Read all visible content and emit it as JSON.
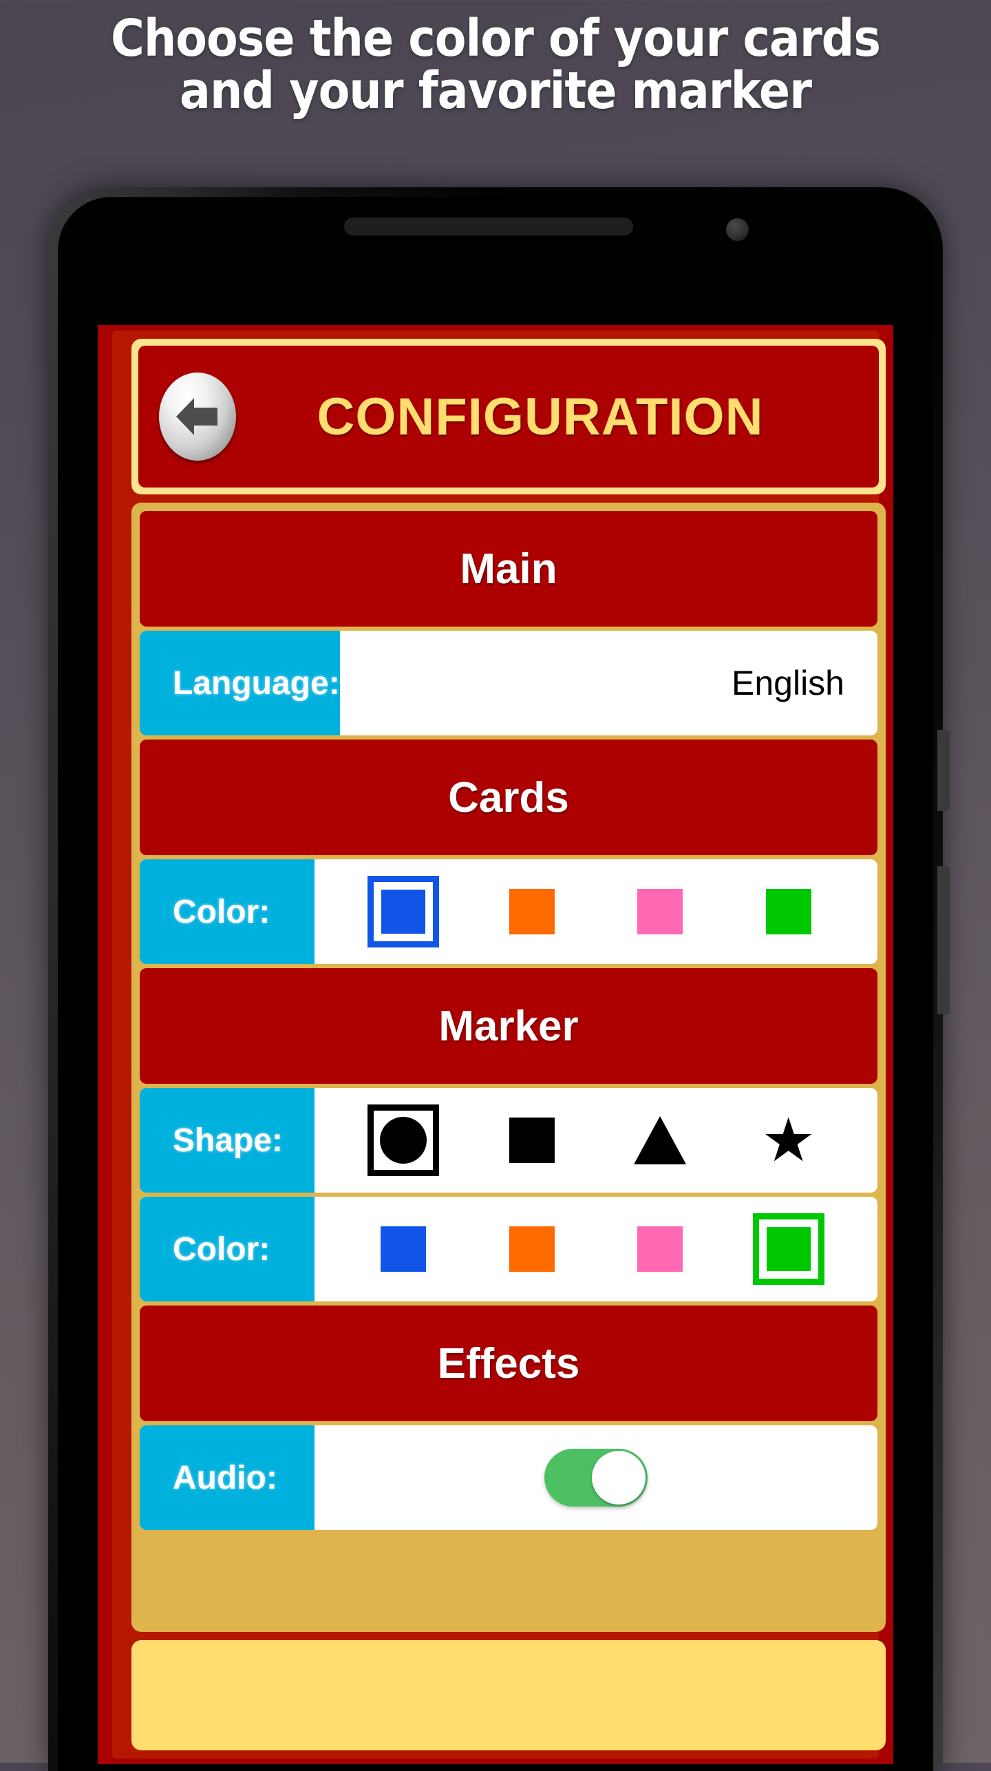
{
  "headline": {
    "line1": "Choose the color of your cards",
    "line2": "and your favorite marker"
  },
  "phone": {
    "speaker_icon": "speaker-grille",
    "camera_icon": "front-camera",
    "power_button": "power-button",
    "volume_button": "volume-button"
  },
  "app": {
    "header": {
      "back_icon": "back-arrow-icon",
      "title": "CONFIGURATION",
      "title_color": "#ffdd6e",
      "bar_color": "#ad0000",
      "frame_color": "#fae48f"
    },
    "sections": [
      {
        "name": "main",
        "heading": "Main",
        "rows": [
          {
            "name": "language",
            "label": "Language:",
            "type": "text",
            "value": "English"
          }
        ]
      },
      {
        "name": "cards",
        "heading": "Cards",
        "rows": [
          {
            "name": "cards-color",
            "label": "Color:",
            "type": "swatches",
            "options": [
              {
                "name": "blue",
                "color": "#1155e8",
                "selected": true
              },
              {
                "name": "orange",
                "color": "#ff6a00",
                "selected": false
              },
              {
                "name": "pink",
                "color": "#ff69b4",
                "selected": false
              },
              {
                "name": "green",
                "color": "#00c800",
                "selected": false
              }
            ]
          }
        ]
      },
      {
        "name": "marker",
        "heading": "Marker",
        "rows": [
          {
            "name": "marker-shape",
            "label": "Shape:",
            "type": "shapes",
            "options": [
              {
                "name": "circle",
                "glyph": "circle",
                "selected": true
              },
              {
                "name": "square",
                "glyph": "square",
                "selected": false
              },
              {
                "name": "triangle",
                "glyph": "triangle",
                "selected": false
              },
              {
                "name": "star",
                "glyph": "star",
                "selected": false
              }
            ]
          },
          {
            "name": "marker-color",
            "label": "Color:",
            "type": "swatches",
            "options": [
              {
                "name": "blue",
                "color": "#1155e8",
                "selected": false
              },
              {
                "name": "orange",
                "color": "#ff6a00",
                "selected": false
              },
              {
                "name": "pink",
                "color": "#ff69b4",
                "selected": false
              },
              {
                "name": "green",
                "color": "#00c800",
                "selected": true
              }
            ]
          }
        ]
      },
      {
        "name": "effects",
        "heading": "Effects",
        "rows": [
          {
            "name": "audio",
            "label": "Audio:",
            "type": "toggle",
            "value": "on",
            "on_color": "#4cc063"
          }
        ]
      }
    ],
    "colors": {
      "screen_red": "#a80000",
      "panel_gold": "#deb44d",
      "header_cream": "#fae48f",
      "section_red": "#ad0000",
      "label_cyan": "#00b0dd",
      "bottom_yellow": "#ffdd6e"
    }
  }
}
